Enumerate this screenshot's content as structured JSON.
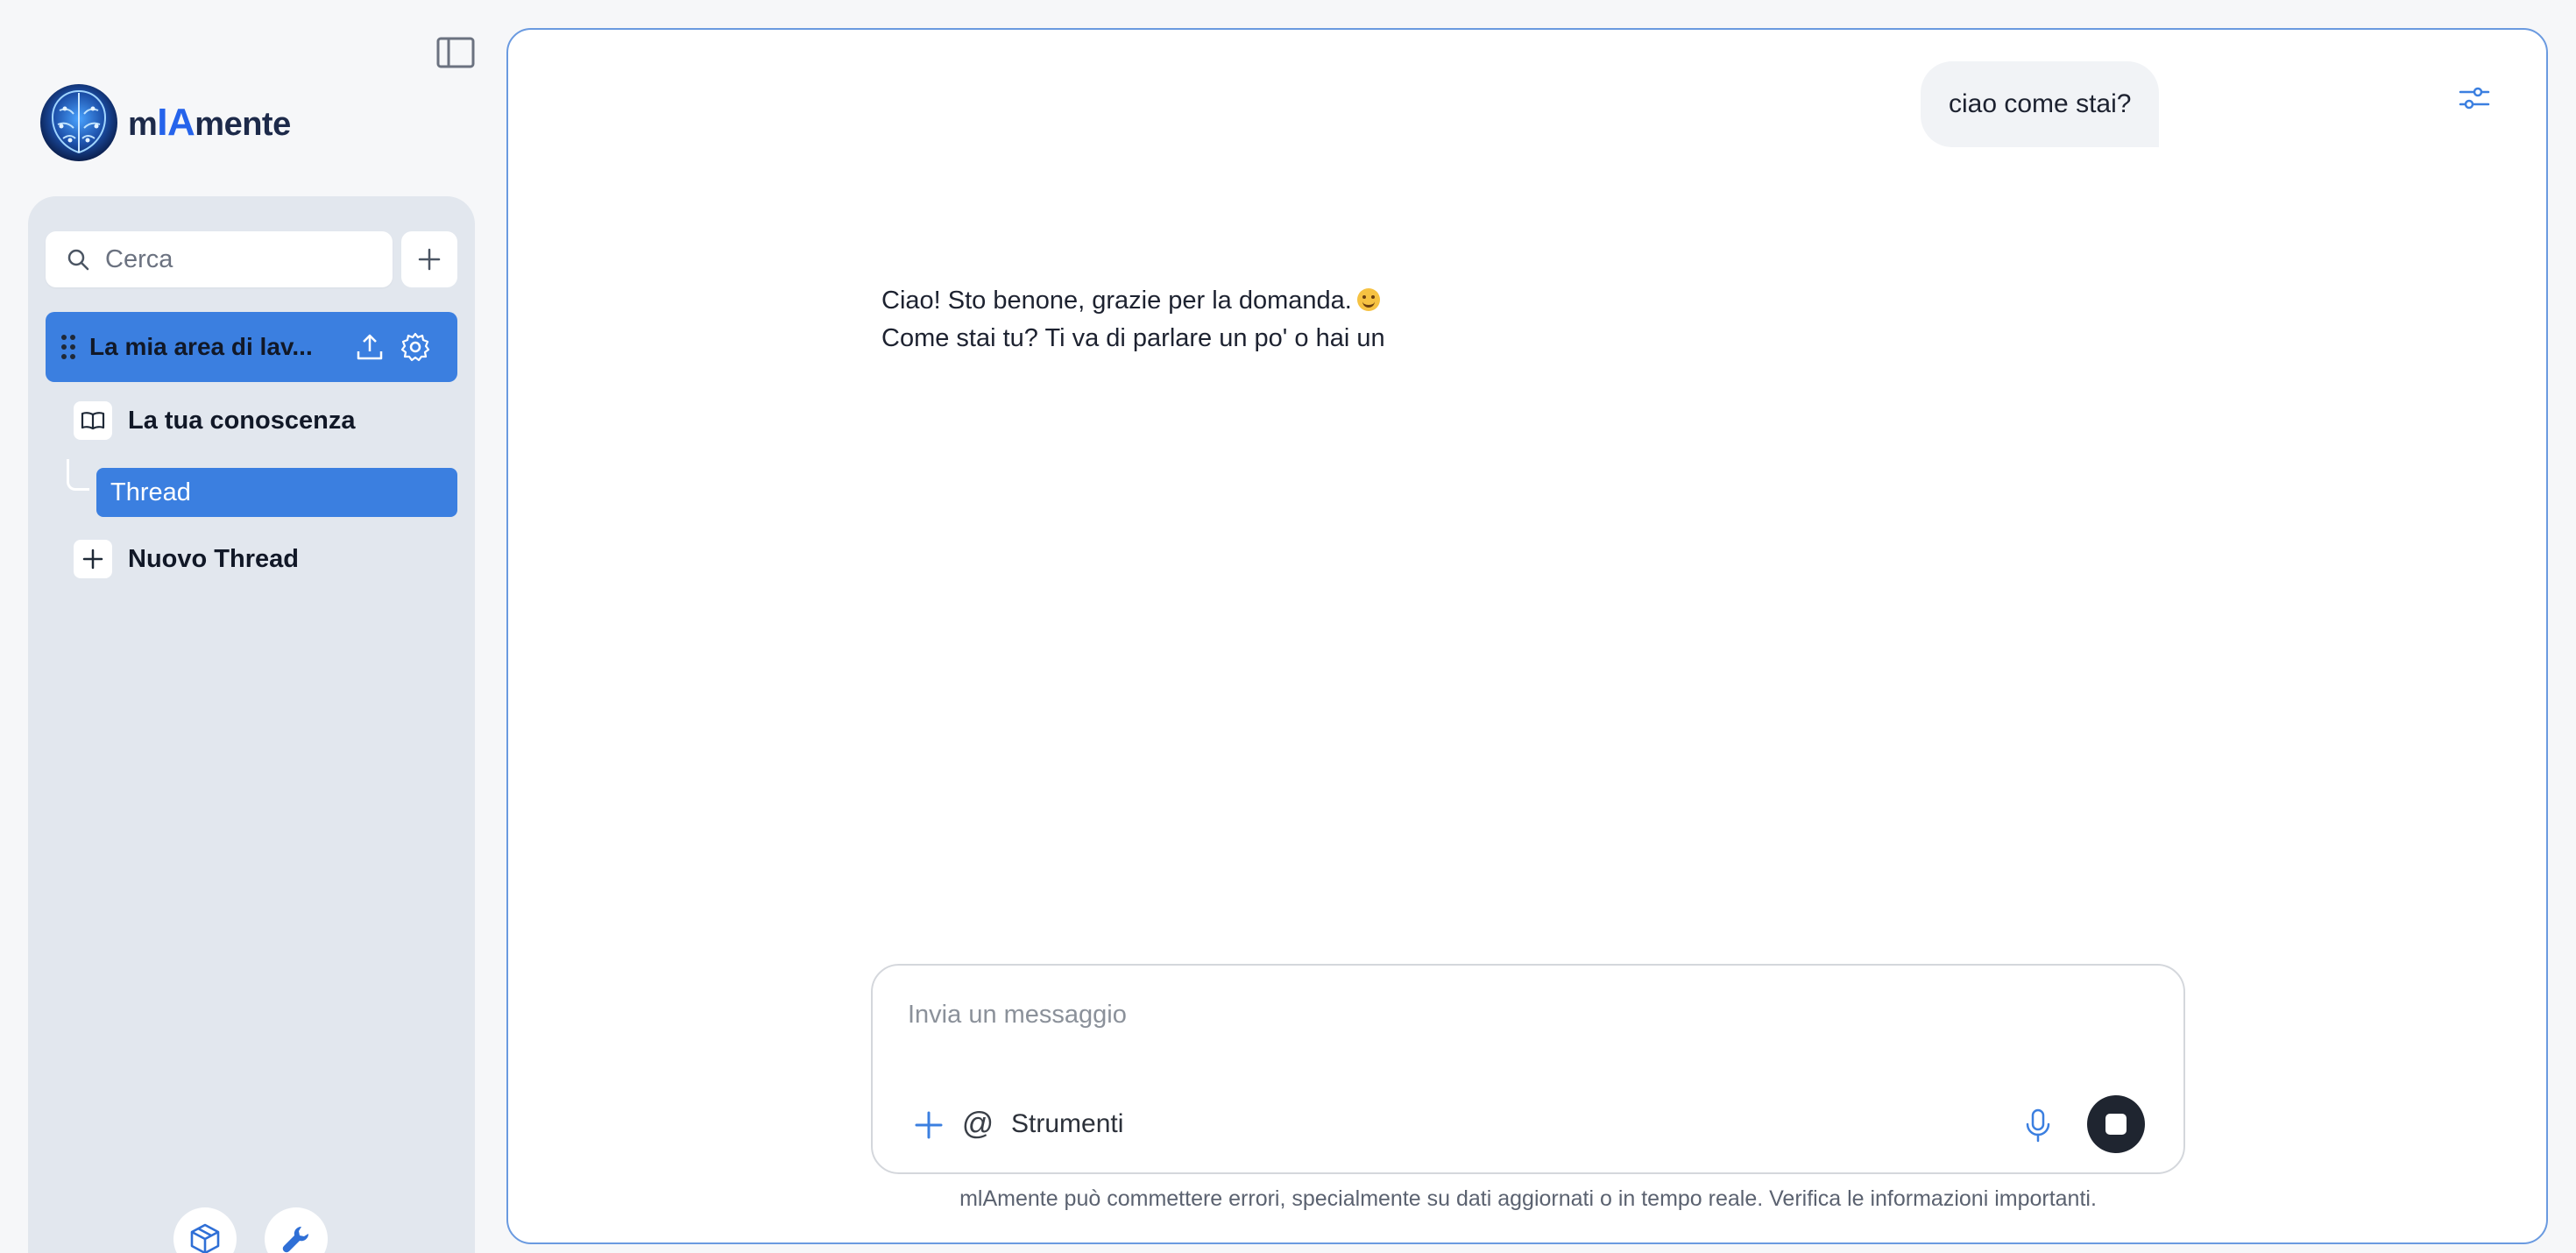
{
  "brand": {
    "name_prefix": "m",
    "name_accent": "IA",
    "name_suffix": "mente",
    "accent_color": "#2563eb"
  },
  "sidebar": {
    "search": {
      "placeholder": "Cerca",
      "value": ""
    },
    "workspace": {
      "label": "La mia area di lav..."
    },
    "items": {
      "knowledge": {
        "label": "La tua conoscenza",
        "icon": "book-open-icon"
      },
      "thread": {
        "label": "Thread"
      },
      "new_thread": {
        "label": "Nuovo Thread",
        "icon": "plus-icon"
      }
    },
    "bottom_buttons": [
      "package-icon",
      "wrench-icon"
    ],
    "active_color": "#3b7fe0"
  },
  "chat": {
    "user_message": "ciao come stai?",
    "assistant_message": {
      "line1": "Ciao! Sto benone, grazie per la domanda.",
      "line2": "Come stai tu? Ti va di parlare un po' o hai un"
    }
  },
  "composer": {
    "placeholder": "Invia un messaggio",
    "value": "",
    "tools_label": "Strumenti",
    "at_symbol": "@"
  },
  "disclaimer": "mlAmente può commettere errori, specialmente su dati aggiornati o in tempo reale. Verifica le informazioni importanti."
}
